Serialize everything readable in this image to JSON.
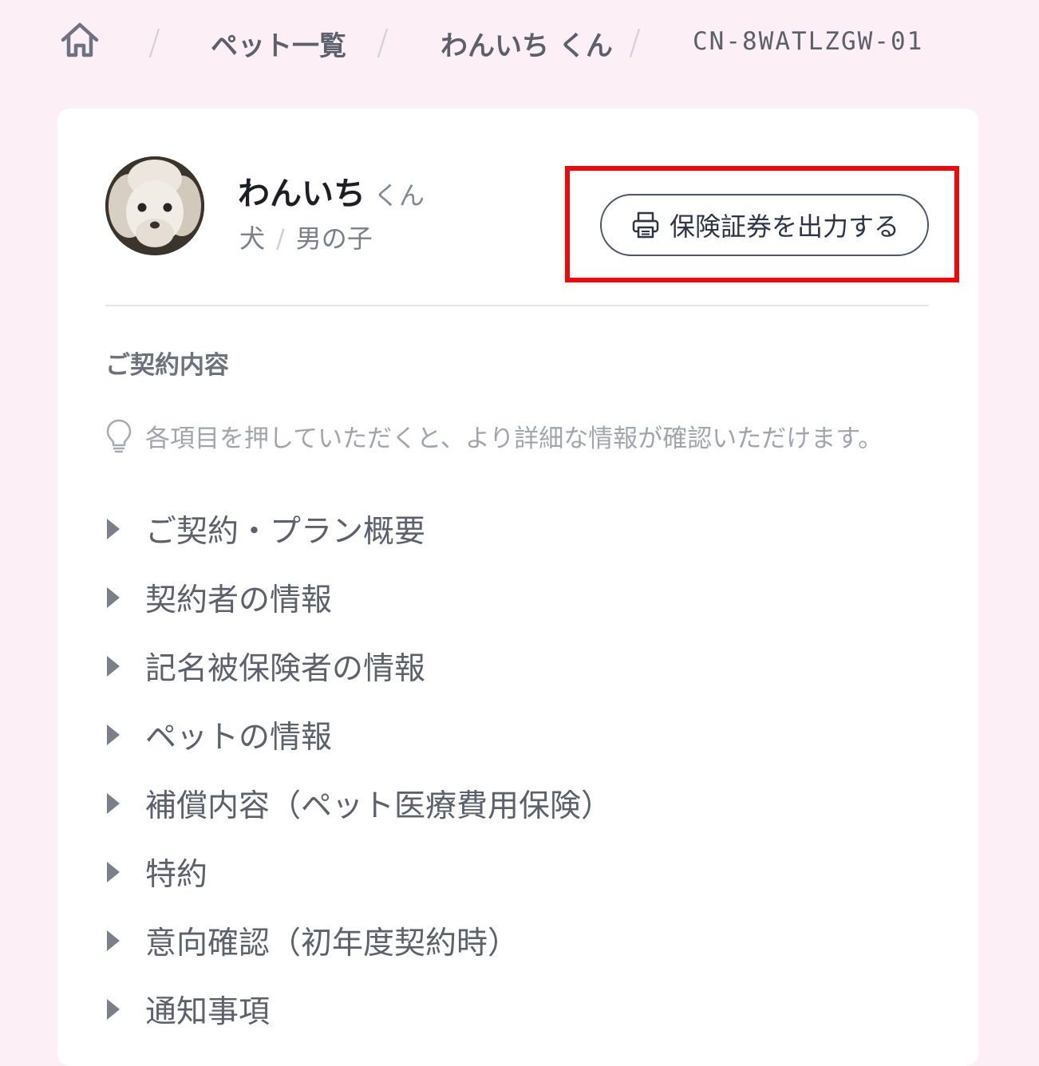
{
  "breadcrumb": {
    "home_icon": "home-icon",
    "separator": "/",
    "items": [
      "ペット一覧",
      "わんいち くん"
    ],
    "current": "CN-8WATLZGW-01"
  },
  "pet": {
    "name": "わんいち",
    "honorific": "くん",
    "species": "犬",
    "sex": "男の子",
    "avatar": "poodle-photo"
  },
  "print_button": {
    "label": "保険証券を出力する",
    "icon": "printer-icon",
    "highlight_color": "#ee0a0a"
  },
  "contract": {
    "section_title": "ご契約内容",
    "hint_icon": "lightbulb-icon",
    "hint": "各項目を押していただくと、より詳細な情報が確認いただけます。",
    "items": [
      "ご契約・プラン概要",
      "契約者の情報",
      "記名被保険者の情報",
      "ペットの情報",
      "補償内容（ペット医療費用保険）",
      "特約",
      "意向確認（初年度契約時）",
      "通知事項"
    ]
  },
  "colors": {
    "page_background": "#fcf0f6",
    "card_background": "#ffffff",
    "button_border": "#4b5470"
  }
}
